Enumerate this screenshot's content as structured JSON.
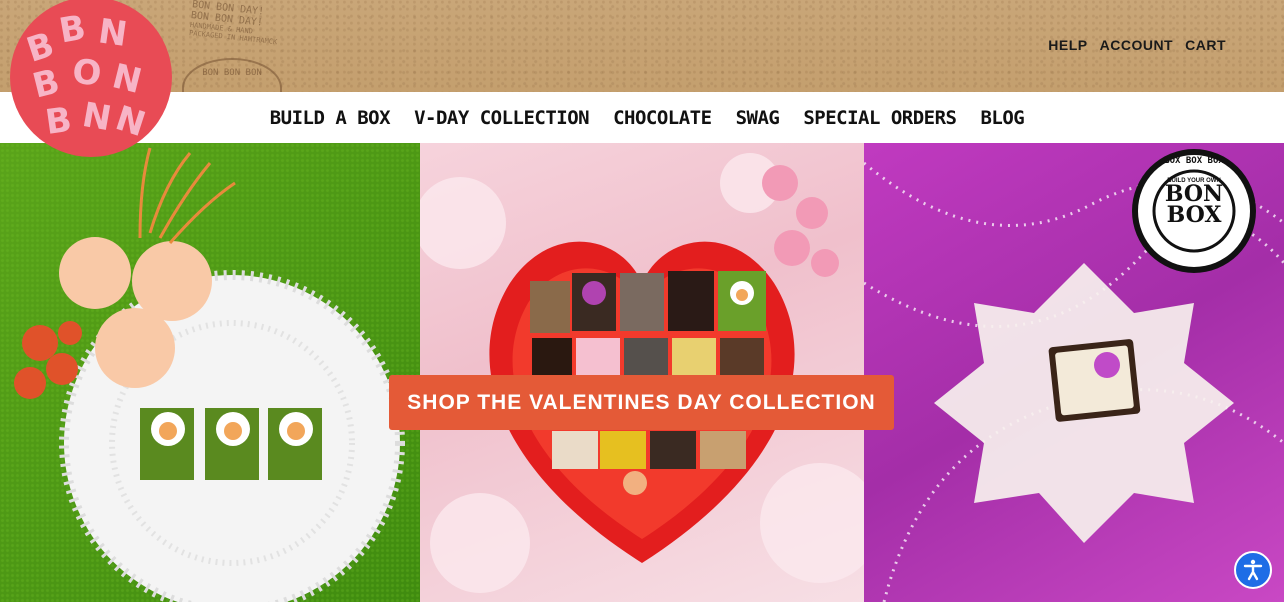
{
  "brand": {
    "name": "BON BON BON",
    "accent": "#e84b55"
  },
  "utility_nav": [
    {
      "label": "HELP"
    },
    {
      "label": "ACCOUNT"
    },
    {
      "label": "CART"
    }
  ],
  "main_nav": [
    {
      "label": "BUILD A BOX"
    },
    {
      "label": "V-DAY COLLECTION"
    },
    {
      "label": "CHOCOLATE"
    },
    {
      "label": "SWAG"
    },
    {
      "label": "SPECIAL ORDERS"
    },
    {
      "label": "BLOG"
    }
  ],
  "stamp": {
    "line1": "BON BON DAY!",
    "line2": "HANDMADE & HAND PACKAGED IN HAMTRAMCK",
    "arc": "BON BON BON"
  },
  "hero": {
    "cta_label": "SHOP THE VALENTINES DAY COLLECTION",
    "cta_color": "#e45a37",
    "badge": {
      "top": "BOX BOX BOX",
      "line1": "BUILD YOUR OWN",
      "line2": "BON",
      "line3": "BOX"
    }
  },
  "accessibility": {
    "icon": "accessibility-icon",
    "color": "#1e6de6"
  }
}
